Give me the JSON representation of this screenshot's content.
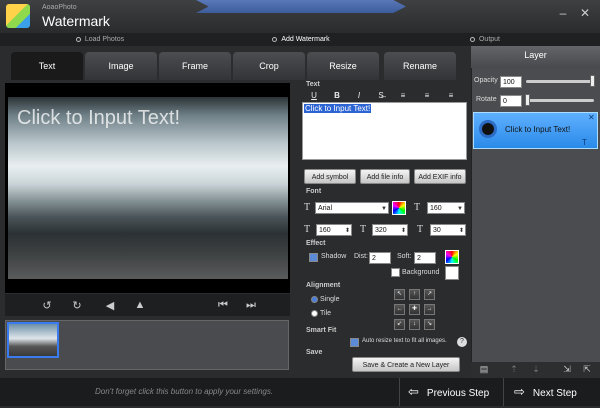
{
  "app": {
    "brand_small": "AoaoPhoto",
    "title": "Watermark"
  },
  "window_controls": {
    "minimize": "–",
    "close": "✕"
  },
  "steps": [
    {
      "label": "Load Photos"
    },
    {
      "label": "Add Watermark"
    },
    {
      "label": "Output"
    }
  ],
  "tabs": [
    {
      "label": "Text"
    },
    {
      "label": "Image"
    },
    {
      "label": "Frame"
    },
    {
      "label": "Crop"
    },
    {
      "label": "Resize"
    },
    {
      "label": "Rename"
    }
  ],
  "active_tab": "Text",
  "preview": {
    "watermark_text": "Click to Input Text!"
  },
  "text_section": {
    "label": "Text",
    "tools": [
      "U",
      "B",
      "I",
      "≡"
    ],
    "content": "Click to Input Text!",
    "buttons": [
      "Add symbol",
      "Add file info",
      "Add EXIF info"
    ]
  },
  "font_section": {
    "label": "Font",
    "family": "Arial",
    "size": "160",
    "width": "160",
    "height": "320",
    "spacing": "30"
  },
  "effect_section": {
    "label": "Effect",
    "shadow_label": "Shadow",
    "dist_label": "Dist:",
    "dist_value": "2",
    "soft_label": "Soft:",
    "soft_value": "2",
    "background_label": "Background",
    "shadow_checked": true,
    "background_checked": false
  },
  "alignment_section": {
    "label": "Alignment",
    "single": "Single",
    "tile": "Tile",
    "selected": "Single"
  },
  "smartfit_section": {
    "label": "Smart Fit",
    "option": "Auto resize text to fit all images.",
    "help": "?",
    "checked": true
  },
  "save_section": {
    "label": "Save",
    "button": "Save & Create a New Layer"
  },
  "layer_panel": {
    "title": "Layer",
    "opacity_label": "Opacity",
    "opacity_value": "100",
    "opacity_level": 1.0,
    "rotate_label": "Rotate",
    "rotate_value": "0",
    "rotate_level": 0.0,
    "item_label": "Click to Input Text!"
  },
  "footer": {
    "hint": "Don't forget click this button to apply your settings.",
    "prev": "Previous Step",
    "next": "Next Step"
  },
  "colors": {
    "accent": "#2a8ae8",
    "step_active": "#4a6aaa",
    "background": "#2b2c2e"
  }
}
